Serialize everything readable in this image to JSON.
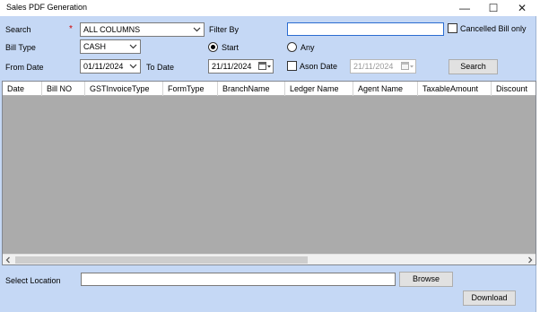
{
  "window": {
    "title": "Sales PDF Generation",
    "minimize_glyph": "—",
    "maximize_glyph": "☐",
    "close_glyph": "✕"
  },
  "form": {
    "search_label": "Search",
    "required_mark": "*",
    "search_value": "ALL COLUMNS",
    "filter_by_label": "Filter By",
    "filter_value": "",
    "cancelled_bill_label": "Cancelled Bill only",
    "bill_type_label": "Bill Type",
    "bill_type_value": "CASH",
    "start_label": "Start",
    "any_label": "Any",
    "from_date_label": "From Date",
    "from_date_value": "01/11/2024",
    "to_date_label": "To Date",
    "to_date_value": "21/11/2024",
    "ason_date_label": "Ason Date",
    "ason_date_value": "21/11/2024",
    "search_button": "Search"
  },
  "grid": {
    "columns": [
      "Date",
      "Bill NO",
      "GSTInvoiceType",
      "FormType",
      "BranchName",
      "Ledger Name",
      "Agent Name",
      "TaxableAmount",
      "Discount"
    ],
    "rows": []
  },
  "bottom": {
    "select_location_label": "Select Location",
    "location_value": "",
    "browse_button": "Browse",
    "download_button": "Download"
  },
  "colors": {
    "form_background": "#c5d8f5",
    "grid_background": "#ababab",
    "required_mark": "#d00000"
  },
  "icons": {
    "dropdown": "chevron-down-icon",
    "calendar": "calendar-icon",
    "scroll_left": "scroll-left-arrow-icon",
    "scroll_right": "scroll-right-arrow-icon"
  }
}
